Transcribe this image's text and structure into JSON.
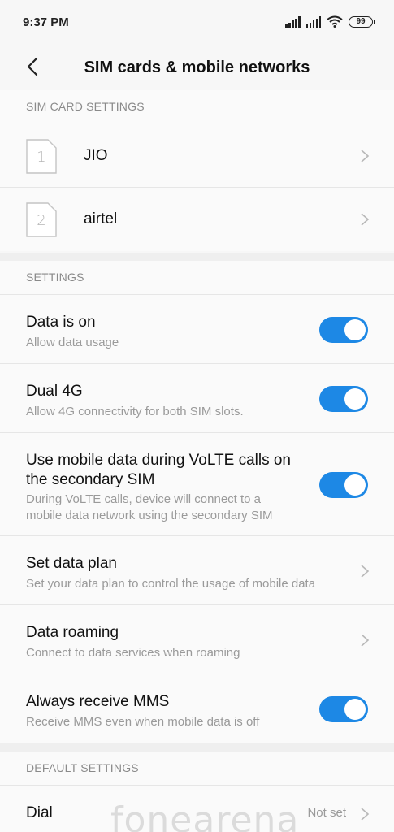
{
  "status_bar": {
    "time": "9:37 PM",
    "battery": "99"
  },
  "header": {
    "title": "SIM cards & mobile networks"
  },
  "sim_section": {
    "header": "SIM CARD SETTINGS",
    "sims": [
      {
        "slot": "1",
        "name": "JIO"
      },
      {
        "slot": "2",
        "name": "airtel"
      }
    ]
  },
  "settings_section": {
    "header": "SETTINGS",
    "items": [
      {
        "title": "Data is on",
        "subtitle": "Allow data usage",
        "control": "toggle",
        "on": true
      },
      {
        "title": "Dual 4G",
        "subtitle": "Allow 4G connectivity for both SIM slots.",
        "control": "toggle",
        "on": true
      },
      {
        "title_line1": "Use mobile data during VoLTE calls on",
        "title_line2": "the secondary SIM",
        "subtitle_line1": "During VoLTE calls, device will connect to a",
        "subtitle_line2": "mobile data network using the secondary SIM",
        "control": "toggle",
        "on": true
      },
      {
        "title": "Set data plan",
        "subtitle": "Set your data plan to control the usage of mobile data",
        "control": "chevron"
      },
      {
        "title": "Data roaming",
        "subtitle": "Connect to data services when roaming",
        "control": "chevron"
      },
      {
        "title": "Always receive MMS",
        "subtitle": "Receive MMS even when mobile data is off",
        "control": "toggle",
        "on": true
      }
    ]
  },
  "default_section": {
    "header": "DEFAULT SETTINGS",
    "items": [
      {
        "title": "Dial",
        "value": "Not set",
        "control": "chevron"
      }
    ]
  },
  "watermark": "fonearena",
  "colors": {
    "accent": "#1d88e5",
    "background": "#f7f7f7",
    "secondary_text": "#9a9a9a"
  }
}
